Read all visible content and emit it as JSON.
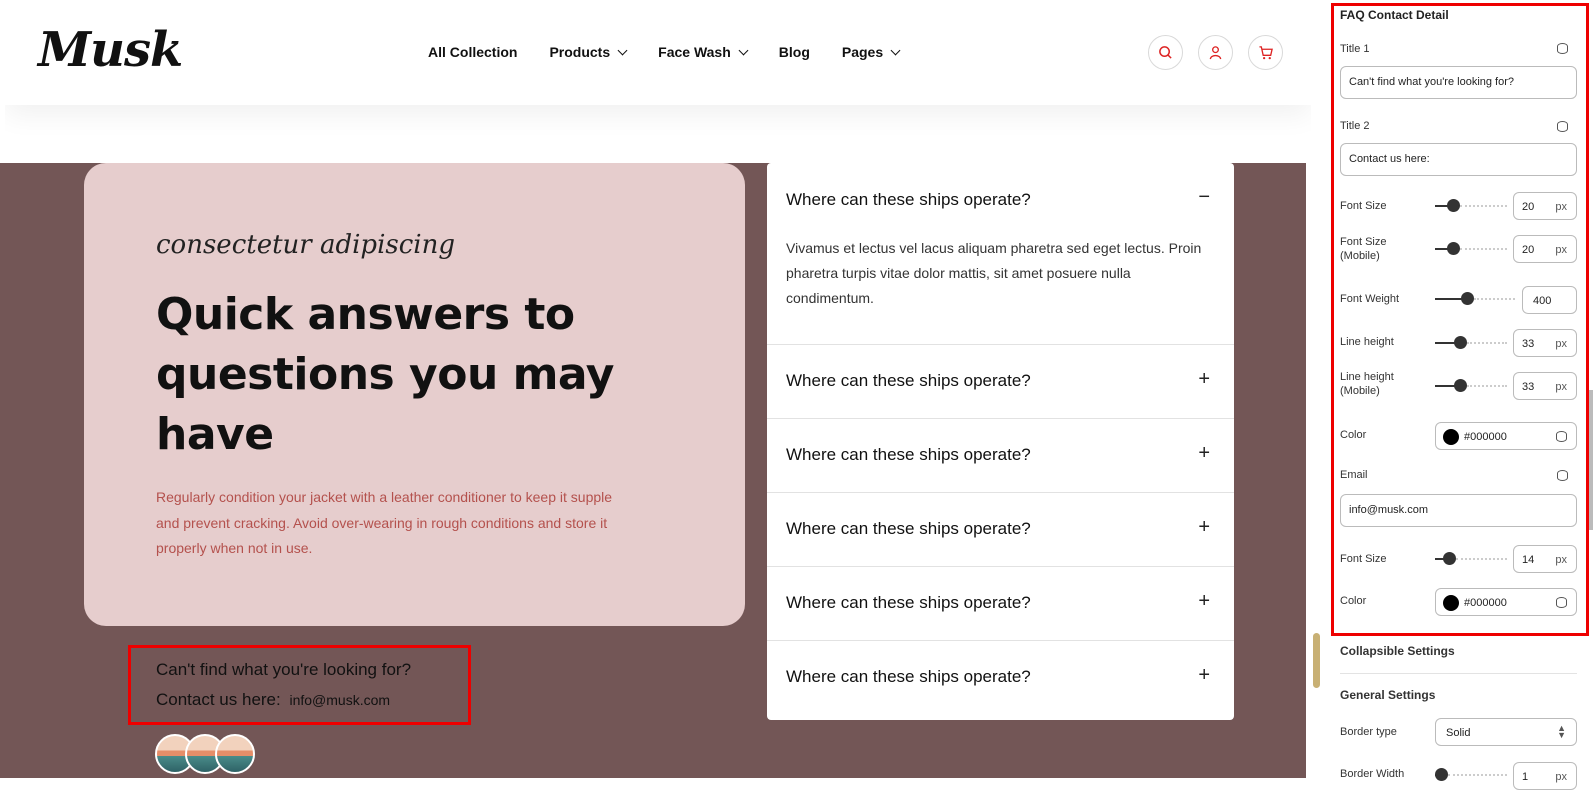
{
  "header": {
    "logo": "Musk",
    "nav": [
      "All Collection",
      "Products",
      "Face Wash",
      "Blog",
      "Pages"
    ],
    "nav_dropdowns": [
      false,
      true,
      true,
      false,
      true
    ],
    "icons": [
      "search-icon",
      "user-icon",
      "cart-icon"
    ]
  },
  "hero": {
    "script_text": "consectetur adipiscing",
    "heading": "Quick answers to questions you may have",
    "description": "Regularly condition your jacket with a leather conditioner to keep it supple and prevent cracking. Avoid over-wearing in rough conditions and store it properly when not in use."
  },
  "contact": {
    "title1": "Can't find what you're looking for?",
    "title2": "Contact us here:",
    "email": "info@musk.com"
  },
  "faq": {
    "items": [
      {
        "question": "Where can these ships operate?",
        "answer": "Vivamus et lectus vel lacus aliquam pharetra sed eget lectus. Proin pharetra turpis vitae dolor mattis, sit amet posuere nulla condimentum.",
        "open": true,
        "sign": "−"
      },
      {
        "question": "Where can these ships operate?",
        "sign": "+"
      },
      {
        "question": "Where can these ships operate?",
        "sign": "+"
      },
      {
        "question": "Where can these ships operate?",
        "sign": "+"
      },
      {
        "question": "Where can these ships operate?",
        "sign": "+"
      },
      {
        "question": "Where can these ships operate?",
        "sign": "+"
      }
    ]
  },
  "panel": {
    "section_title": "FAQ Contact Detail",
    "title1_label": "Title 1",
    "title1_value": "Can't find what you're looking for?",
    "title2_label": "Title 2",
    "title2_value": "Contact us here:",
    "font_size_label": "Font Size",
    "font_size_value": "20",
    "font_size_mobile_label": "Font Size (Mobile)",
    "font_size_mobile_value": "20",
    "font_weight_label": "Font Weight",
    "font_weight_value": "400",
    "line_height_label": "Line height",
    "line_height_value": "33",
    "line_height_mobile_label": "Line height (Mobile)",
    "line_height_mobile_value": "33",
    "color_label": "Color",
    "color_value": "#000000",
    "email_label": "Email",
    "email_value": "info@musk.com",
    "email_font_size_label": "Font Size",
    "email_font_size_value": "14",
    "email_color_label": "Color",
    "email_color_value": "#000000",
    "unit": "px",
    "collapsible_title": "Collapsible Settings",
    "general_title": "General Settings",
    "border_type_label": "Border type",
    "border_type_value": "Solid",
    "border_width_label": "Border Width",
    "border_width_value": "1"
  },
  "colors": {
    "band": "#735656",
    "card": "#e6cdcd",
    "desc": "#b4514d",
    "highlight": "#e00000"
  }
}
